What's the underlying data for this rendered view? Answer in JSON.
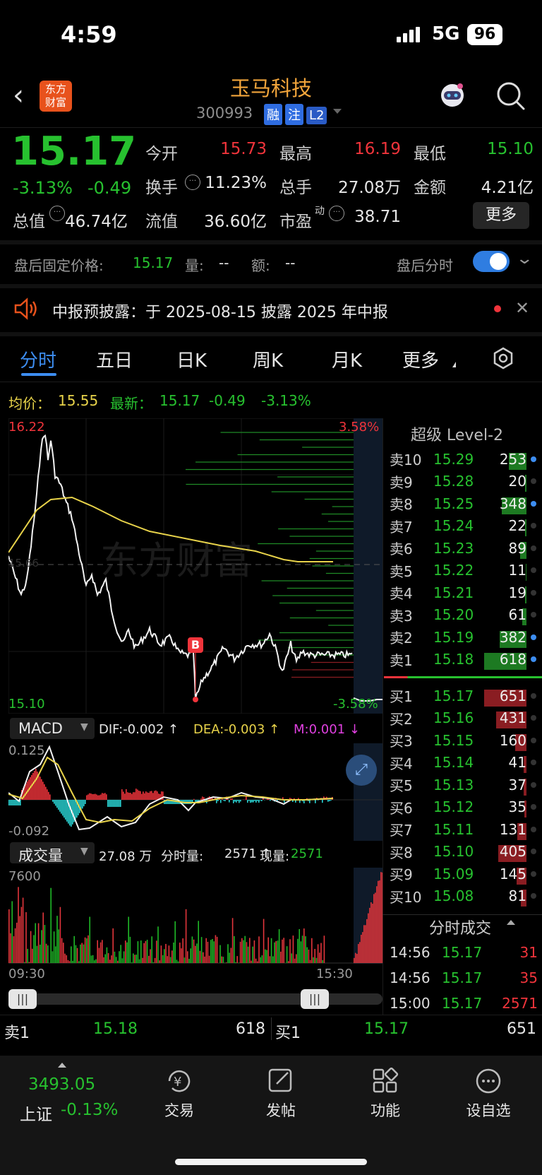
{
  "status_bar": {
    "time": "4:59",
    "network": "5G",
    "battery": "96"
  },
  "header": {
    "logo": "东方\n财富",
    "title": "玉马科技",
    "code": "300993",
    "tags": [
      "融",
      "注",
      "L2"
    ]
  },
  "quote": {
    "price": "15.17",
    "pct": "-3.13%",
    "chg": "-0.49",
    "stats": [
      {
        "label": "今开",
        "value": "15.73"
      },
      {
        "label": "最高",
        "value": "16.19"
      },
      {
        "label": "最低",
        "value": "15.10"
      },
      {
        "label": "换手",
        "value": "11.23%"
      },
      {
        "label": "总手",
        "value": "27.08万"
      },
      {
        "label": "金额",
        "value": "4.21亿"
      },
      {
        "label": "总值",
        "value": "46.74亿"
      },
      {
        "label": "流值",
        "value": "36.60亿"
      },
      {
        "label": "市盈",
        "sup": "动",
        "value": "38.71"
      }
    ],
    "more_label": "更多"
  },
  "after_hours": {
    "label": "盘后固定价格:",
    "price": "15.17",
    "vol_label": "量:",
    "vol": "--",
    "amt_label": "额:",
    "amt": "--",
    "toggle_label": "盘后分时"
  },
  "notice": {
    "text": "中报预披露：于 2025-08-15 披露 2025 年中报"
  },
  "tabs": [
    "分时",
    "五日",
    "日K",
    "周K",
    "月K",
    "更多"
  ],
  "info_line": {
    "avg_label": "均价：",
    "avg": "15.55",
    "latest_label": "最新：",
    "latest": "15.17",
    "chg": "-0.49",
    "pct": "-3.13%"
  },
  "chart": {
    "top_price": "16.22",
    "top_pct": "3.58%",
    "bottom_price": "15.10",
    "bottom_pct": "-3.58%",
    "mid_label": "15.66",
    "marker": "B",
    "watermark": "东方财富",
    "macd_label": "MACD",
    "dif": "DIF:-0.002 ↑",
    "dea": "DEA:-0.003 ↑",
    "m": "M:0.001 ↓",
    "macd_top": "0.125",
    "macd_bottom": "-0.092",
    "vol_label": "成交量",
    "vol_total": "27.08 万",
    "vol_fs_label": "分时量:",
    "vol_fs": "2571 ↑",
    "vol_now_label": "现量:",
    "vol_now": "2571",
    "vol_top": "7600",
    "time_start": "09:30",
    "time_end": "15:30"
  },
  "orderbook": {
    "title": "超级 Level-2",
    "asks": [
      {
        "l": "卖10",
        "p": "15.29",
        "q": "253"
      },
      {
        "l": "卖9",
        "p": "15.28",
        "q": "20"
      },
      {
        "l": "卖8",
        "p": "15.25",
        "q": "348"
      },
      {
        "l": "卖7",
        "p": "15.24",
        "q": "22"
      },
      {
        "l": "卖6",
        "p": "15.23",
        "q": "89"
      },
      {
        "l": "卖5",
        "p": "15.22",
        "q": "11"
      },
      {
        "l": "卖4",
        "p": "15.21",
        "q": "19"
      },
      {
        "l": "卖3",
        "p": "15.20",
        "q": "61"
      },
      {
        "l": "卖2",
        "p": "15.19",
        "q": "382"
      },
      {
        "l": "卖1",
        "p": "15.18",
        "q": "618"
      }
    ],
    "bids": [
      {
        "l": "买1",
        "p": "15.17",
        "q": "651"
      },
      {
        "l": "买2",
        "p": "15.16",
        "q": "431"
      },
      {
        "l": "买3",
        "p": "15.15",
        "q": "160"
      },
      {
        "l": "买4",
        "p": "15.14",
        "q": "41"
      },
      {
        "l": "买5",
        "p": "15.13",
        "q": "37"
      },
      {
        "l": "买6",
        "p": "15.12",
        "q": "35"
      },
      {
        "l": "买7",
        "p": "15.11",
        "q": "131"
      },
      {
        "l": "买8",
        "p": "15.10",
        "q": "405"
      },
      {
        "l": "买9",
        "p": "15.09",
        "q": "145"
      },
      {
        "l": "买10",
        "p": "15.08",
        "q": "81"
      }
    ],
    "trades_title": "分时成交",
    "trades": [
      {
        "t": "14:56",
        "p": "15.17",
        "v": "31"
      },
      {
        "t": "14:56",
        "p": "15.17",
        "v": "35"
      },
      {
        "t": "15:00",
        "p": "15.17",
        "v": "2571"
      }
    ]
  },
  "bottom_quote": {
    "ask_label": "卖1",
    "ask_price": "15.18",
    "ask_vol": "618",
    "bid_label": "买1",
    "bid_price": "15.17",
    "bid_vol": "651"
  },
  "nav": {
    "index_value": "3493.05",
    "index_name": "上证",
    "index_pct": "-0.13%",
    "items": [
      {
        "label": "交易",
        "icon": "yen-cycle-icon"
      },
      {
        "label": "发帖",
        "icon": "edit-icon"
      },
      {
        "label": "功能",
        "icon": "grid-icon"
      },
      {
        "label": "设自选",
        "icon": "more-dots-icon"
      }
    ]
  }
}
